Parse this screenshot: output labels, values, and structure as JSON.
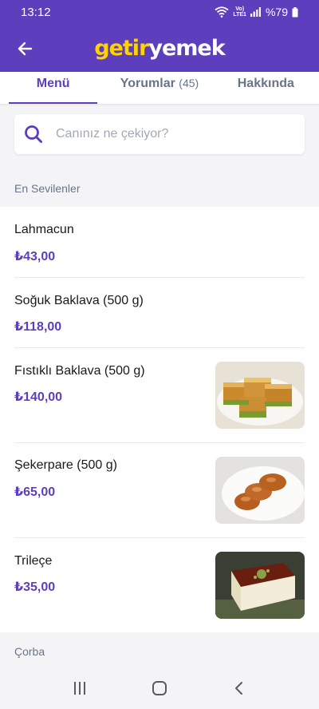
{
  "status_bar": {
    "time": "13:12",
    "network": "VoLTE LTE1",
    "battery": "%79"
  },
  "header": {
    "logo_part1": "getir",
    "logo_part2": "yemek"
  },
  "tabs": [
    {
      "label": "Menü",
      "count": ""
    },
    {
      "label": "Yorumlar",
      "count": "(45)"
    },
    {
      "label": "Hakkında",
      "count": ""
    }
  ],
  "search": {
    "placeholder": "Canınız ne çekiyor?"
  },
  "sections": {
    "favorites": "En Sevilenler",
    "soup": "Çorba"
  },
  "items": [
    {
      "name": "Lahmacun",
      "price": "₺43,00",
      "image": ""
    },
    {
      "name": "Soğuk Baklava (500 g)",
      "price": "₺118,00",
      "image": ""
    },
    {
      "name": "Fıstıklı Baklava (500 g)",
      "price": "₺140,00",
      "image": "baklava-photo"
    },
    {
      "name": "Şekerpare (500 g)",
      "price": "₺65,00",
      "image": "sekerpare-photo"
    },
    {
      "name": "Trileçe",
      "price": "₺35,00",
      "image": "trilece-photo"
    }
  ],
  "colors": {
    "brand_purple": "#5d3ebc",
    "brand_yellow": "#ffd300"
  }
}
